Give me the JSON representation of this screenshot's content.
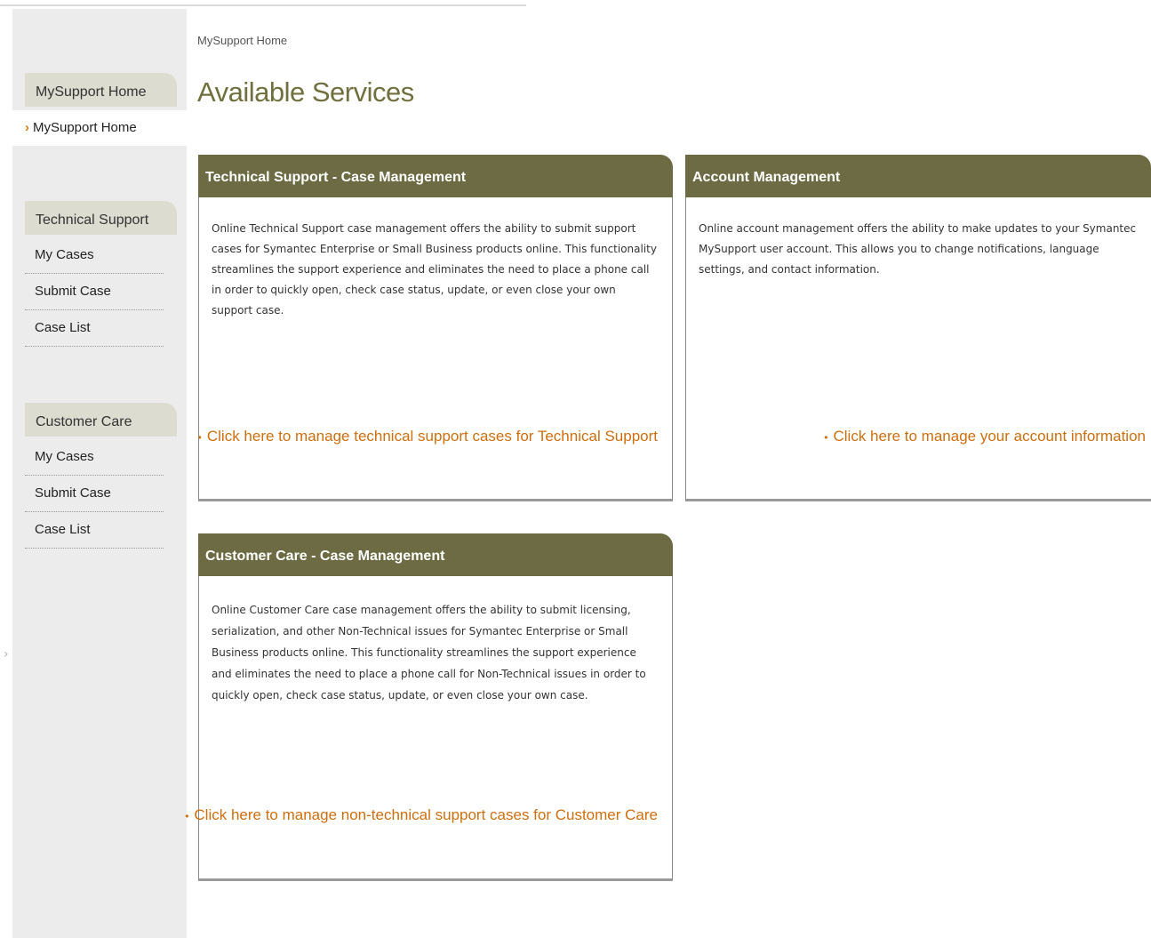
{
  "breadcrumb": "MySupport Home",
  "page_title": "Available Services",
  "sidebar": {
    "groups": [
      {
        "header": "MySupport Home",
        "items": [
          {
            "label": "MySupport Home",
            "selected": true
          }
        ]
      },
      {
        "header": "Technical Support",
        "items": [
          {
            "label": "My Cases"
          },
          {
            "label": "Submit Case"
          },
          {
            "label": "Case List"
          }
        ]
      },
      {
        "header": "Customer Care",
        "items": [
          {
            "label": "My Cases"
          },
          {
            "label": "Submit Case"
          },
          {
            "label": "Case List"
          }
        ]
      }
    ]
  },
  "panels": {
    "tech": {
      "title": "Technical Support - Case Management",
      "body": "Online Technical Support case management offers the ability to submit support cases for Symantec Enterprise or Small Business products online. This functionality streamlines the support experience and eliminates the need to place a phone call in order to quickly open, check case status, update, or even close your own support case.",
      "link": "Click here to manage technical support cases for Technical Support"
    },
    "account": {
      "title": "Account Management",
      "body": "Online account management offers the ability to make updates to your Symantec MySupport user account. This allows you to change notifications, language settings, and contact information.",
      "link": "Click here to manage your account information"
    },
    "care": {
      "title": "Customer Care - Case Management",
      "body": "Online Customer Care case management offers the ability to submit licensing, serialization, and other Non-Technical issues for Symantec Enterprise or Small Business products online. This functionality streamlines the support experience and eliminates the need to place a phone call for Non-Technical issues in order to quickly open, check case status, update, or even close your own case.",
      "link": "Click here to manage non-technical support cases for Customer Care"
    }
  },
  "colors": {
    "panel_header": "#6d6b43",
    "title": "#70703e",
    "link": "#cc6f0e",
    "selected_arrow": "#d07a10",
    "sidebar": "#ececec"
  }
}
